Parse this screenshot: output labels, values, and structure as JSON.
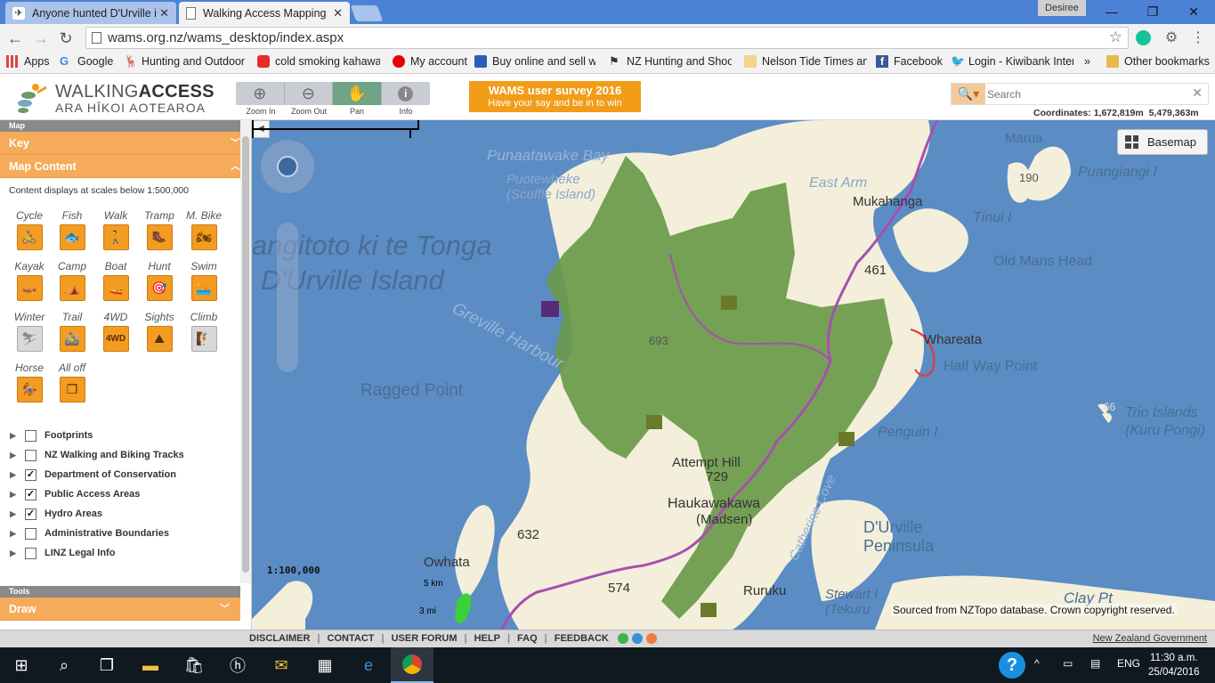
{
  "browser": {
    "tabs": [
      {
        "title": "Anyone hunted D'Urville i",
        "active": false
      },
      {
        "title": "Walking Access Mapping",
        "active": true
      }
    ],
    "user": "Desiree",
    "url": "wams.org.nz/wams_desktop/index.aspx",
    "bookmarks": [
      "Apps",
      "Google",
      "Hunting and Outdoor",
      "cold smoking kahawa",
      "My account",
      "Buy online and sell wi",
      "NZ Hunting and Shoo",
      "Nelson Tide Times an",
      "Facebook",
      "Login - Kiwibank Inter",
      "»",
      "Other bookmarks"
    ]
  },
  "header": {
    "logo_line1a": "WALKING",
    "logo_line1b": "ACCESS",
    "logo_line2": "ARA HĪKOI AOTEAROA",
    "tools": [
      "Zoom In",
      "Zoom Out",
      "Pan",
      "Info"
    ],
    "survey_title": "WAMS user survey 2016",
    "survey_sub": "Have your say and be in to win",
    "search_placeholder": "Search",
    "coords_label": "Coordinates:",
    "coords_e": "1,672,819m",
    "coords_n": "5,479,363m"
  },
  "panel": {
    "map_section": "Map",
    "key": "Key",
    "map_content": "Map Content",
    "scale_note": "Content displays at scales below 1:500,000",
    "activities": [
      {
        "label": "Cycle",
        "icon": "cycle-icon",
        "glyph": "🚴",
        "on": true
      },
      {
        "label": "Fish",
        "icon": "fish-icon",
        "glyph": "🐟",
        "on": true
      },
      {
        "label": "Walk",
        "icon": "walk-icon",
        "glyph": "🚶",
        "on": true
      },
      {
        "label": "Tramp",
        "icon": "tramp-icon",
        "glyph": "🥾",
        "on": true
      },
      {
        "label": "M. Bike",
        "icon": "motorbike-icon",
        "glyph": "🏍",
        "on": true
      },
      {
        "label": "Kayak",
        "icon": "kayak-icon",
        "glyph": "🛶",
        "on": true
      },
      {
        "label": "Camp",
        "icon": "camp-icon",
        "glyph": "⛺",
        "on": true
      },
      {
        "label": "Boat",
        "icon": "boat-icon",
        "glyph": "🚤",
        "on": true
      },
      {
        "label": "Hunt",
        "icon": "hunt-icon",
        "glyph": "🎯",
        "on": true
      },
      {
        "label": "Swim",
        "icon": "swim-icon",
        "glyph": "🏊",
        "on": true
      },
      {
        "label": "Winter",
        "icon": "winter-icon",
        "glyph": "⛷",
        "on": false
      },
      {
        "label": "Trail",
        "icon": "trail-icon",
        "glyph": "🚵",
        "on": true
      },
      {
        "label": "4WD",
        "icon": "4wd-icon",
        "glyph": "4WD",
        "on": true
      },
      {
        "label": "Sights",
        "icon": "sights-icon",
        "glyph": "⛰",
        "on": true
      },
      {
        "label": "Climb",
        "icon": "climb-icon",
        "glyph": "🧗",
        "on": false
      },
      {
        "label": "Horse",
        "icon": "horse-icon",
        "glyph": "🏇",
        "on": true
      },
      {
        "label": "All off",
        "icon": "all-off-icon",
        "glyph": "❐",
        "on": true
      }
    ],
    "layers": [
      {
        "label": "Footprints",
        "checked": false
      },
      {
        "label": "NZ Walking and Biking Tracks",
        "checked": false
      },
      {
        "label": "Department of Conservation",
        "checked": true
      },
      {
        "label": "Public Access Areas",
        "checked": true
      },
      {
        "label": "Hydro Areas",
        "checked": true
      },
      {
        "label": "Administrative Boundaries",
        "checked": false
      },
      {
        "label": "LINZ Legal Info",
        "checked": false
      }
    ],
    "tools_section": "Tools",
    "draw": "Draw"
  },
  "map": {
    "basemap": "Basemap",
    "scale": "1:100,000",
    "scale_km": "5 km",
    "scale_mi": "3 mi",
    "copyright": "Sourced from NZTopo database. Crown copyright reserved.",
    "water_labels": [
      "Punaatawake Bay",
      "angitoto ki te Tonga",
      "D'Urville Island",
      "Greville Harbour",
      "Ragged Point",
      "East Arm",
      "Puangiangi I",
      "Tinui I",
      "Old Mans Head",
      "Half Way Point",
      "Penguin I",
      "Trio Islands",
      "(Kuru Pongi)",
      "Catherine Cove",
      "D'Urville",
      "Peninsula",
      "Stewart I",
      "(Tekuru",
      "Clay Pt",
      "Marua",
      "Puotewheke",
      "(Scuffle Island)"
    ],
    "land_labels": [
      "Mukahanga",
      "Whareata",
      "Attempt Hill",
      "729",
      "Haukawakawa",
      "(Madsen)",
      "632",
      "Owhata",
      "574",
      "Ruruku",
      "461",
      "190",
      "693",
      "66"
    ],
    "colors": {
      "sea": "#5b8cc4",
      "land": "#f4f0dc",
      "conservation": "#6a9a4a",
      "track": "#a650b0",
      "accent": "#f29c1a"
    }
  },
  "footer": {
    "links": [
      "DISCLAIMER",
      "CONTACT",
      "USER FORUM",
      "HELP",
      "FAQ",
      "FEEDBACK"
    ],
    "gov": "New Zealand Government"
  },
  "taskbar": {
    "lang": "ENG",
    "time": "11:30 a.m.",
    "date": "25/04/2016"
  }
}
